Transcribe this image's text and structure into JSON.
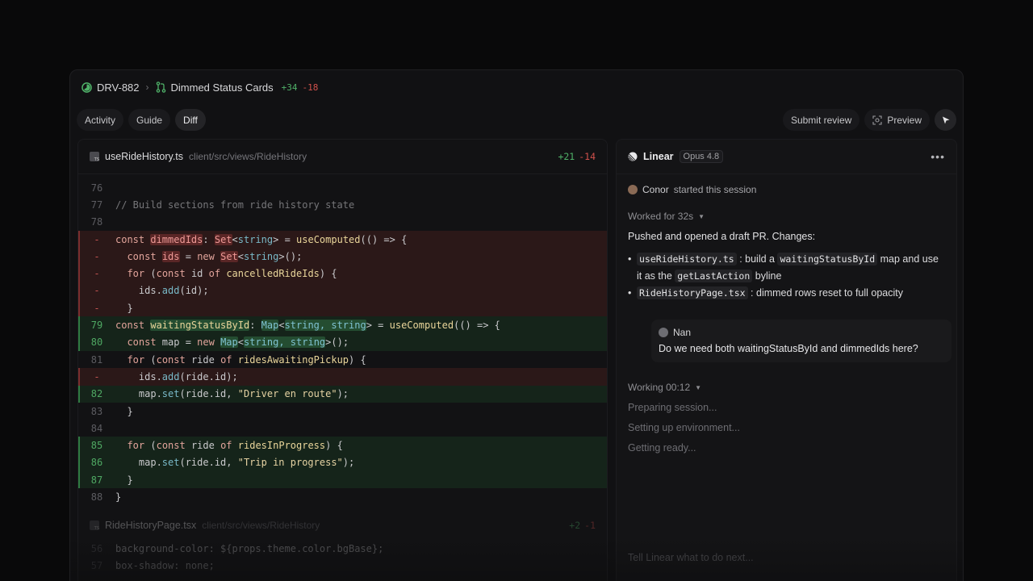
{
  "breadcrumb": {
    "issue_id": "DRV-882",
    "pr_title": "Dimmed Status Cards",
    "additions": "+34",
    "deletions": "-18"
  },
  "tabs": [
    {
      "label": "Activity"
    },
    {
      "label": "Guide"
    },
    {
      "label": "Diff",
      "active": true
    }
  ],
  "actions": {
    "submit_review": "Submit review",
    "preview": "Preview"
  },
  "diff": {
    "file1": {
      "name": "useRideHistory.ts",
      "path": "client/src/views/RideHistory",
      "additions": "+21",
      "deletions": "-14"
    },
    "file2": {
      "name": "RideHistoryPage.tsx",
      "path": "client/src/views/RideHistory",
      "additions": "+2",
      "deletions": "-1",
      "line56_no": "56",
      "line56": "background-color: ${props.theme.color.bgBase};",
      "line57_no": "57",
      "line57": "box-shadow: none;"
    }
  },
  "chat": {
    "agent_name": "Linear",
    "model": "Opus 4.8",
    "session_user": "Conor",
    "session_text": "started this session",
    "worked_for": "Worked for 32s",
    "summary": "Pushed and opened a draft PR. Changes:",
    "change1_code1": "useRideHistory.ts",
    "change1_t1": ": build a",
    "change1_code2": "waitingStatusById",
    "change1_t2": "map and",
    "change1_t3": "use it as the",
    "change1_code3": "getLastAction",
    "change1_t4": "byline",
    "change2_code": "RideHistoryPage.tsx",
    "change2_text": ": dimmed rows reset to full opacity",
    "quote_author": "Nan",
    "quote_text": "Do we need both waitingStatusById and dimmedIds here?",
    "working": "Working 00:12",
    "steps": [
      "Preparing session...",
      "Setting up environment...",
      "Getting ready..."
    ],
    "composer_placeholder": "Tell Linear what to do next..."
  },
  "colors": {
    "add": "#4fb168",
    "del": "#d2514c",
    "background": "#09090a",
    "panel": "#111113"
  }
}
